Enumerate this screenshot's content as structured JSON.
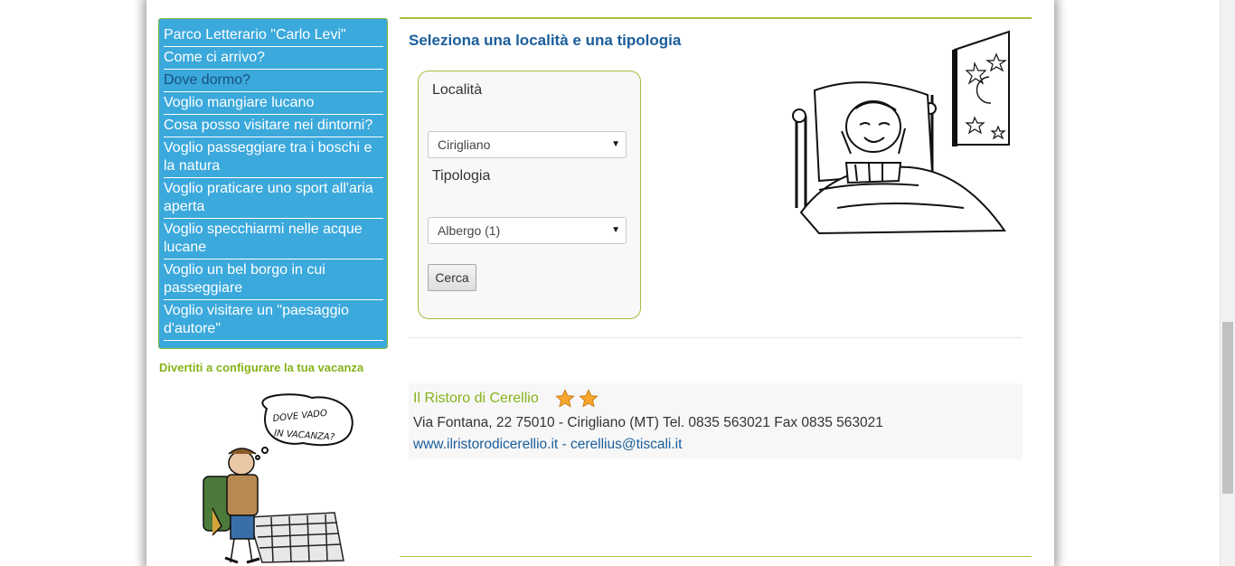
{
  "nav": {
    "items": [
      {
        "label": "Parco Letterario \"Carlo Levi\""
      },
      {
        "label": "Come ci arrivo?"
      },
      {
        "label": "Dove dormo?"
      },
      {
        "label": "Voglio mangiare lucano"
      },
      {
        "label": "Cosa posso visitare nei dintorni?"
      },
      {
        "label": "Voglio passeggiare tra i boschi e la natura"
      },
      {
        "label": "Voglio praticare uno sport all'aria aperta"
      },
      {
        "label": "Voglio specchiarmi nelle acque lucane"
      },
      {
        "label": "Voglio un bel borgo in cui passeggiare"
      },
      {
        "label": "Voglio visitare un \"paesaggio d'autore\""
      }
    ]
  },
  "promo": {
    "title": "Divertiti a configurare la tua vacanza",
    "bubble_text_1": "DOVE VADO",
    "bubble_text_2": "IN VACANZA?"
  },
  "main": {
    "title": "Seleziona una località e una tipologia",
    "form": {
      "localita_label": "Località",
      "localita_value": "Cirigliano",
      "tipologia_label": "Tipologia",
      "tipologia_value": "Albergo (1)",
      "search_label": "Cerca"
    }
  },
  "result": {
    "name": "Il Ristoro di Cerellio",
    "stars": 2,
    "address": "Via Fontana, 22 75010 - Cirigliano (MT) Tel. 0835 563021 Fax 0835 563021",
    "website": "www.ilristorodicerellio.it",
    "separator": " - ",
    "email": "cerellius@tiscali.it"
  },
  "colors": {
    "nav_bg": "#3ba9dc",
    "accent_green": "#86b31a",
    "title_blue": "#1b5e9b"
  }
}
